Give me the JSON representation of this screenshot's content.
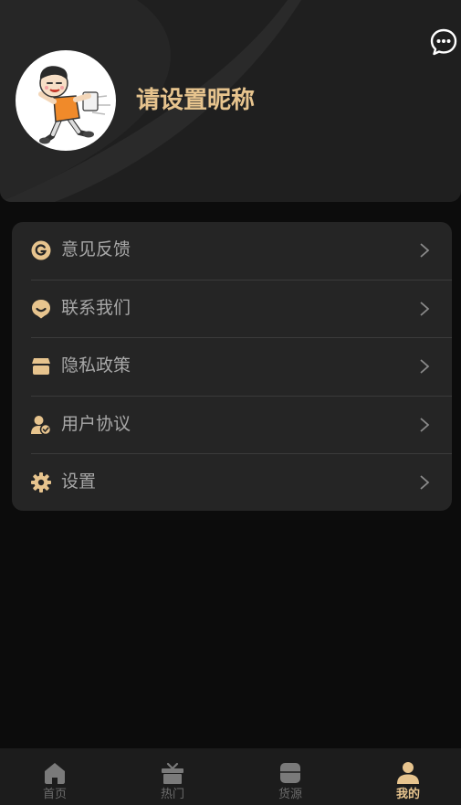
{
  "profile": {
    "nickname": "请设置昵称"
  },
  "menu": {
    "items": [
      {
        "label": "意见反馈",
        "icon": "feedback-icon"
      },
      {
        "label": "联系我们",
        "icon": "contact-icon"
      },
      {
        "label": "隐私政策",
        "icon": "privacy-icon"
      },
      {
        "label": "用户协议",
        "icon": "user-agreement-icon"
      },
      {
        "label": "设置",
        "icon": "settings-icon"
      }
    ]
  },
  "tabbar": {
    "tabs": [
      {
        "label": "首页",
        "icon": "home-icon",
        "active": false
      },
      {
        "label": "热门",
        "icon": "gift-icon",
        "active": false
      },
      {
        "label": "货源",
        "icon": "box-icon",
        "active": false
      },
      {
        "label": "我的",
        "icon": "user-icon",
        "active": true
      }
    ]
  },
  "colors": {
    "accent": "#e7c48e",
    "background": "#0c0c0c",
    "card": "#252525",
    "header": "#1f1f1f"
  }
}
